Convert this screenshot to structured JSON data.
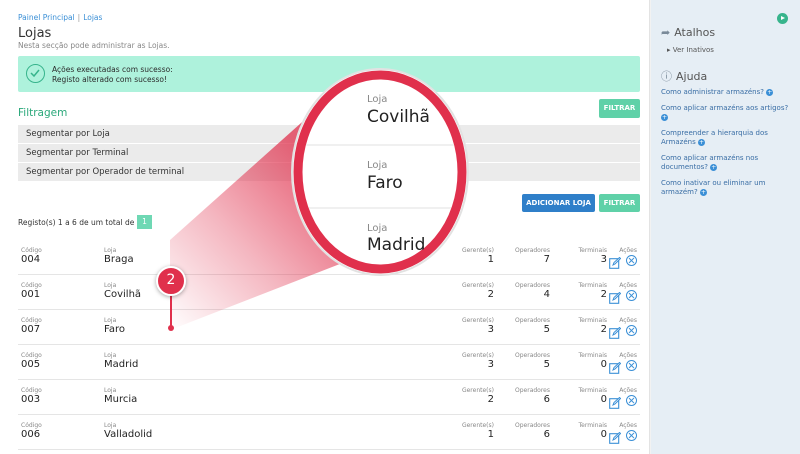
{
  "breadcrumb": {
    "home": "Painel Principal",
    "current": "Lojas"
  },
  "page": {
    "title": "Lojas",
    "subtitle": "Nesta secção pode administrar as Lojas."
  },
  "alert": {
    "line1": "Ações executadas com sucesso:",
    "line2": "Registo alterado com sucesso!"
  },
  "filter": {
    "title": "Filtragem",
    "button": "FILTRAR",
    "options": [
      {
        "prefix": "Segmentar por",
        "field": "Loja"
      },
      {
        "prefix": "Segmentar por",
        "field": "Terminal"
      },
      {
        "prefix": "Segmentar por",
        "field": "Operador de terminal"
      }
    ]
  },
  "actions": {
    "add": "ADICIONAR LOJA",
    "filter": "FILTRAR"
  },
  "pagination": {
    "summary": "Registo(s) 1 a 6 de um total de 6",
    "page": "1"
  },
  "columns": {
    "code": "Código",
    "store": "Loja",
    "managers": "Gerente(s)",
    "operators": "Operadores",
    "terminals": "Terminais",
    "actions": "Ações"
  },
  "rows": [
    {
      "code": "004",
      "store": "Braga",
      "managers": "1",
      "operators": "7",
      "terminals": "3"
    },
    {
      "code": "001",
      "store": "Covilhã",
      "managers": "2",
      "operators": "4",
      "terminals": "2"
    },
    {
      "code": "007",
      "store": "Faro",
      "managers": "3",
      "operators": "5",
      "terminals": "2"
    },
    {
      "code": "005",
      "store": "Madrid",
      "managers": "3",
      "operators": "5",
      "terminals": "0"
    },
    {
      "code": "003",
      "store": "Murcia",
      "managers": "2",
      "operators": "6",
      "terminals": "0"
    },
    {
      "code": "006",
      "store": "Valladolid",
      "managers": "1",
      "operators": "6",
      "terminals": "0"
    }
  ],
  "sidebar": {
    "shortcuts_title": "Atalhos",
    "ver_inativos": "Ver Inativos",
    "help_title": "Ajuda",
    "help_links": [
      "Como administrar armazéns?",
      "Como aplicar armazéns aos artigos?",
      "Compreender a hierarquia dos Armazéns",
      "Como aplicar armazéns nos documentos?",
      "Como inativar ou eliminar um armazém?"
    ]
  },
  "zoom": {
    "label": "Loja",
    "items": [
      "Covilhã",
      "Faro",
      "Madrid"
    ]
  },
  "step_badge": "2",
  "colors": {
    "accent_green": "#5fd1a8",
    "primary_blue": "#2f7fc9",
    "highlight_red": "#e0304c",
    "alert_bg": "#aef2dc"
  }
}
